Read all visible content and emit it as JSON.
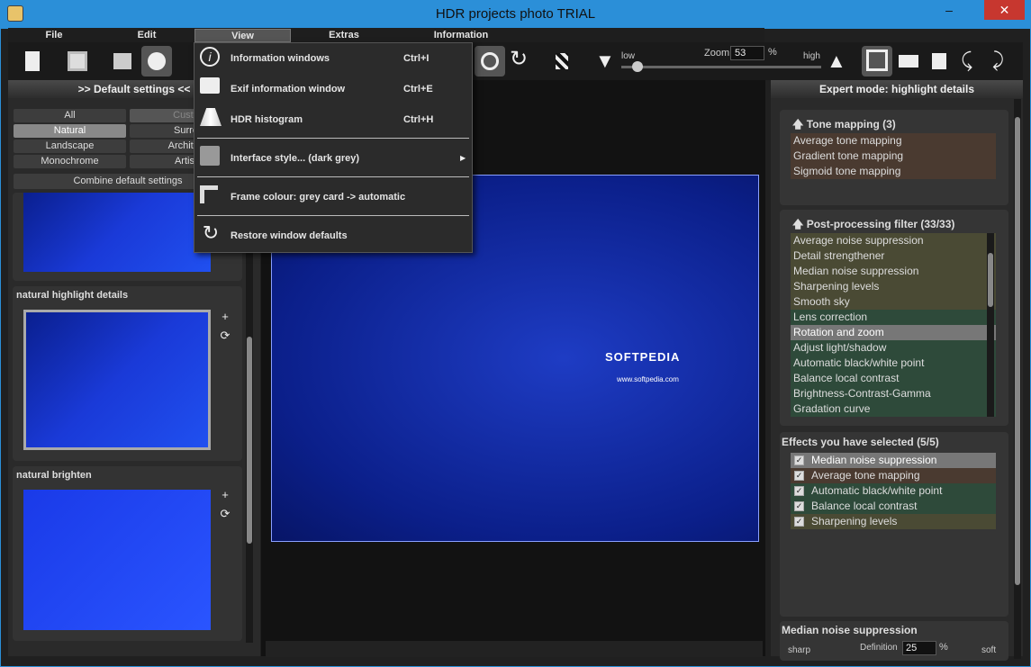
{
  "window": {
    "title": "HDR projects photo  TRIAL",
    "minimize": "–",
    "close": "✕"
  },
  "menu": {
    "file": "File",
    "edit": "Edit",
    "view": "View",
    "extras": "Extras",
    "information": "Information"
  },
  "zoom": {
    "low": "low",
    "label": "Zoom",
    "value": "53",
    "unit": "%",
    "high": "high"
  },
  "left": {
    "header": ">> Default settings <<",
    "filters": [
      "All",
      "Custo",
      "Natural",
      "Surre",
      "Landscape",
      "Architec",
      "Monochrome",
      "Artist"
    ],
    "combine": "Combine default settings",
    "thumbs": [
      {
        "label": "natural highlight details"
      },
      {
        "label": "natural brighten"
      }
    ],
    "plus": "+",
    "reload": "⟳"
  },
  "dropdown": {
    "items": [
      {
        "label": "Information windows",
        "shortcut": "Ctrl+I",
        "icon": "info-icon"
      },
      {
        "label": "Exif information window",
        "shortcut": "Ctrl+E",
        "icon": "camera-exif-icon"
      },
      {
        "label": "HDR histogram",
        "shortcut": "Ctrl+H",
        "icon": "histogram-icon"
      },
      {
        "label": "Interface style... (dark grey)",
        "shortcut": "",
        "icon": "interface-icon"
      },
      {
        "label": "Frame colour: grey card -> automatic",
        "shortcut": "",
        "icon": "frame-icon"
      },
      {
        "label": "Restore window defaults",
        "shortcut": "",
        "icon": "restore-icon"
      }
    ],
    "submenu_arrow": "▶"
  },
  "right": {
    "header": "Expert mode: highlight details",
    "tone_title": "Tone mapping (3)",
    "tone": [
      "Average tone mapping",
      "Gradient tone mapping",
      "Sigmoid tone mapping"
    ],
    "post_title": "Post-processing filter (33/33)",
    "post": [
      "Average noise suppression",
      "Detail strengthener",
      "Median noise suppression",
      "Sharpening levels",
      "Smooth sky",
      "Lens correction",
      "Rotation and zoom",
      "Adjust light/shadow",
      "Automatic black/white point",
      "Balance local contrast",
      "Brightness-Contrast-Gamma",
      "Gradation curve"
    ],
    "selected_title": "Effects you have selected (5/5)",
    "selected": [
      "Median noise suppression",
      "Average tone mapping",
      "Automatic black/white point",
      "Balance local contrast",
      "Sharpening levels"
    ],
    "median_title": "Median noise suppression",
    "sharp": "sharp",
    "definition": "Definition",
    "def_value": "25",
    "pct": "%",
    "soft": "soft",
    "up_arrow": "🡅"
  },
  "watermark": "SOFTPEDIA",
  "watermark_url": "www.softpedia.com"
}
